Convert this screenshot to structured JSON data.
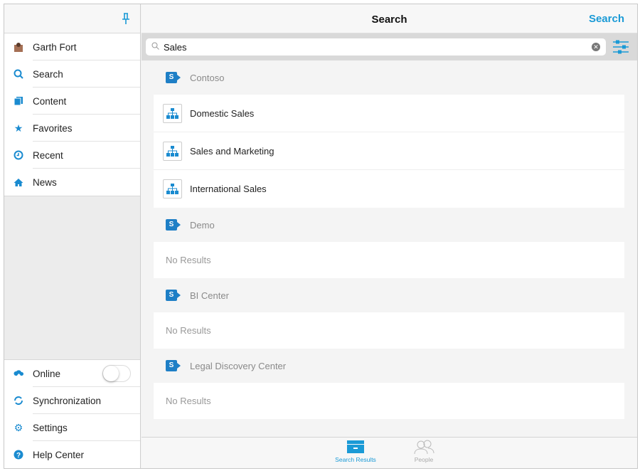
{
  "sidebar": {
    "user": "Garth Fort",
    "items": [
      {
        "label": "Search",
        "icon": "search-icon"
      },
      {
        "label": "Content",
        "icon": "content-icon"
      },
      {
        "label": "Favorites",
        "icon": "star-icon"
      },
      {
        "label": "Recent",
        "icon": "clock-icon"
      },
      {
        "label": "News",
        "icon": "home-icon"
      }
    ],
    "bottom": [
      {
        "label": "Online",
        "icon": "cloud-upload-icon",
        "toggle_on": false
      },
      {
        "label": "Synchronization",
        "icon": "sync-icon"
      },
      {
        "label": "Settings",
        "icon": "gear-icon"
      },
      {
        "label": "Help Center",
        "icon": "help-icon"
      }
    ]
  },
  "header": {
    "title": "Search",
    "action": "Search"
  },
  "search": {
    "value": "Sales"
  },
  "groups": [
    {
      "name": "Contoso",
      "results": [
        "Domestic Sales",
        "Sales and Marketing",
        "International Sales"
      ]
    },
    {
      "name": "Demo",
      "no_results": "No Results"
    },
    {
      "name": "BI Center",
      "no_results": "No Results"
    },
    {
      "name": "Legal Discovery Center",
      "no_results": "No Results"
    }
  ],
  "tabs": [
    {
      "label": "Search Results",
      "active": true
    },
    {
      "label": "People",
      "active": false
    }
  ],
  "colors": {
    "accent": "#1a9ad6"
  }
}
